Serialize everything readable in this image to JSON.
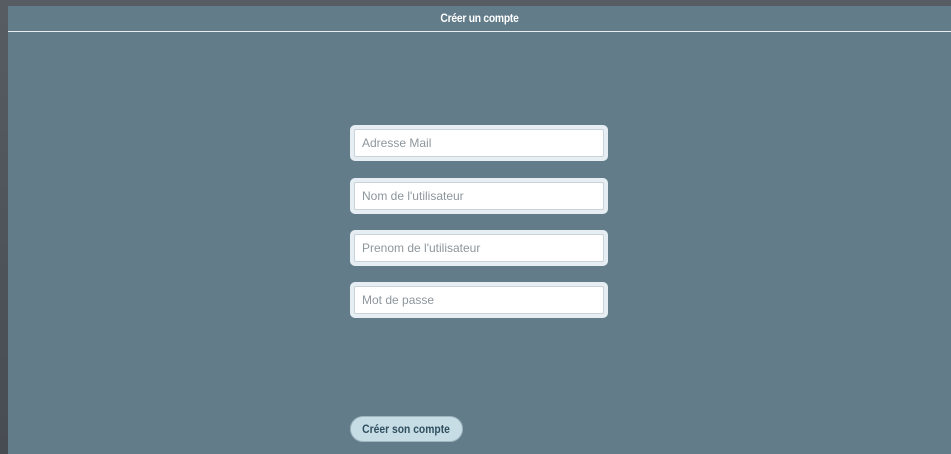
{
  "header": {
    "title": "Créer un compte"
  },
  "form": {
    "fields": [
      {
        "placeholder": "Adresse Mail",
        "value": ""
      },
      {
        "placeholder": "Nom de l'utilisateur",
        "value": ""
      },
      {
        "placeholder": "Prenom de l'utilisateur",
        "value": ""
      },
      {
        "placeholder": "Mot de passe",
        "value": ""
      }
    ],
    "submit_label": "Créer son compte"
  },
  "colors": {
    "background": "#627c89",
    "outer": "#4a5057",
    "button": "#c7dde6",
    "button_text": "#2f4f5f"
  }
}
